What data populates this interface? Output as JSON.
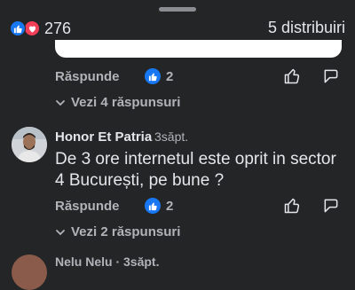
{
  "header": {
    "reaction_count": "276",
    "shares": "5 distribuiri",
    "reaction_icons": [
      "like-icon",
      "love-icon"
    ],
    "colors": {
      "like": "#1877f2",
      "love": "#f33e58",
      "background": "#242526"
    }
  },
  "threads": [
    {
      "reply_label": "Răspunde",
      "like_count": "2",
      "view_replies": "Vezi 4 răspunsuri"
    },
    {
      "author": "Honor Et Patria",
      "time": "3săpt.",
      "text": "De 3 ore internetul este oprit in sector 4 București,  pe bune ?",
      "reply_label": "Răspunde",
      "like_count": "2",
      "view_replies": "Vezi 2 răspunsuri"
    }
  ],
  "next_comment": {
    "partial_text": "Nelu Nelu · 3săpt."
  }
}
